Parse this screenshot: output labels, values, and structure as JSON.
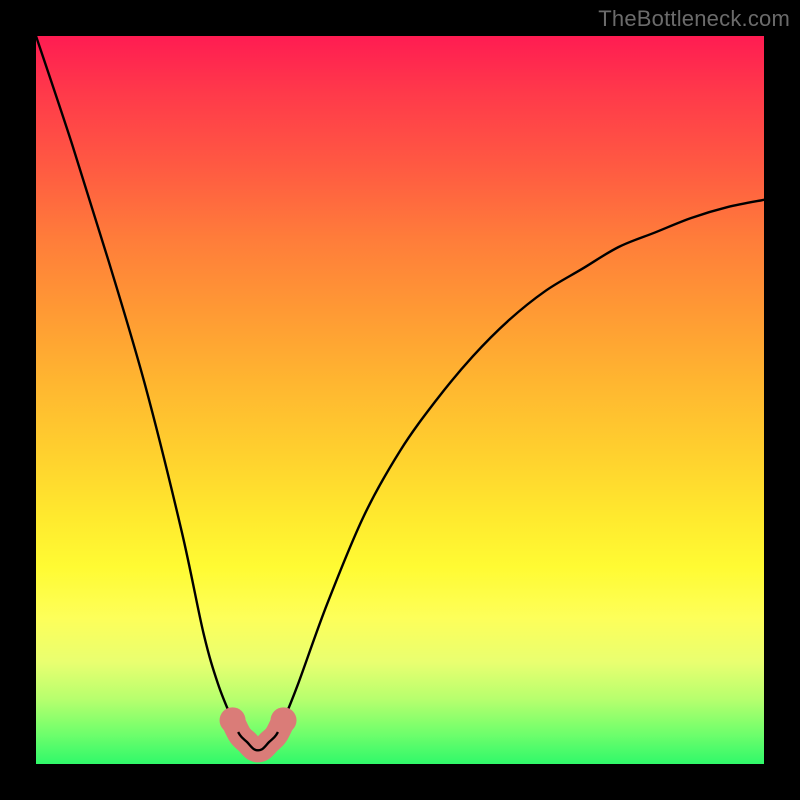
{
  "attribution": "TheBottleneck.com",
  "colors": {
    "background": "#000000",
    "highlight": "#da7c78",
    "curve": "#000000"
  },
  "chart_data": {
    "type": "line",
    "title": "",
    "xlabel": "",
    "ylabel": "",
    "xlim": [
      0,
      100
    ],
    "ylim": [
      0,
      100
    ],
    "legend": false,
    "grid": false,
    "annotations": [
      {
        "text": "TheBottleneck.com",
        "position": "top-right"
      }
    ],
    "series": [
      {
        "name": "bottleneck-curve",
        "x": [
          0,
          5,
          10,
          15,
          20,
          23,
          25,
          27,
          28,
          29,
          30,
          31,
          32,
          33,
          34,
          36,
          40,
          45,
          50,
          55,
          60,
          65,
          70,
          75,
          80,
          85,
          90,
          95,
          100
        ],
        "y": [
          100,
          85,
          69,
          52,
          32,
          18,
          11,
          6,
          4,
          3,
          2,
          2,
          3,
          4,
          6,
          11,
          22,
          34,
          43,
          50,
          56,
          61,
          65,
          68,
          71,
          73,
          75,
          76.5,
          77.5
        ]
      }
    ],
    "highlight_region": {
      "x_range": [
        26.5,
        34
      ],
      "description": "thick pink stroke marking the minimum/valley of the curve"
    }
  }
}
